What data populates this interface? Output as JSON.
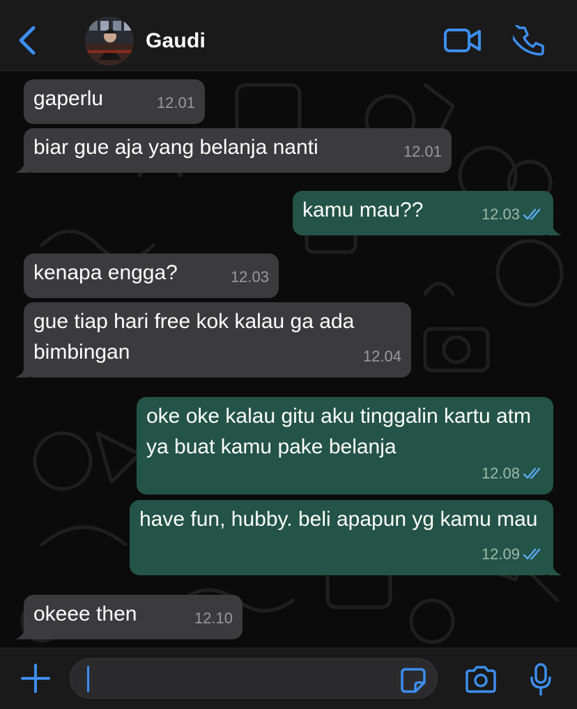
{
  "colors": {
    "accent": "#3d8ef0",
    "incoming_bubble": "#3b3b3d",
    "outgoing_bubble": "#245447",
    "read_ticks": "#5aa8f0",
    "background": "#0b0b0b"
  },
  "header": {
    "back_icon": "chevron-left-icon",
    "contact_name": "Gaudi",
    "video_icon": "video-camera-icon",
    "call_icon": "phone-icon"
  },
  "messages": [
    {
      "dir": "in",
      "text": "gaperlu",
      "time": "12.01"
    },
    {
      "dir": "in",
      "text": "biar gue aja yang belanja nanti",
      "time": "12.01"
    },
    {
      "dir": "out",
      "text": "kamu mau??",
      "time": "12.03",
      "status": "read"
    },
    {
      "dir": "in",
      "text": "kenapa engga?",
      "time": "12.03"
    },
    {
      "dir": "in",
      "text": "gue tiap hari free kok kalau ga ada bimbingan",
      "time": "12.04"
    },
    {
      "dir": "out",
      "text": "oke oke kalau gitu aku tinggalin kartu atm ya buat kamu pake belanja",
      "time": "12.08",
      "status": "read"
    },
    {
      "dir": "out",
      "text": "have fun, hubby. beli apapun yg kamu mau",
      "time": "12.09",
      "status": "read"
    },
    {
      "dir": "in",
      "text": "okeee then",
      "time": "12.10"
    }
  ],
  "composer": {
    "plus_icon": "plus-icon",
    "input_value": "",
    "sticker_icon": "sticker-icon",
    "camera_icon": "camera-icon",
    "mic_icon": "microphone-icon"
  }
}
